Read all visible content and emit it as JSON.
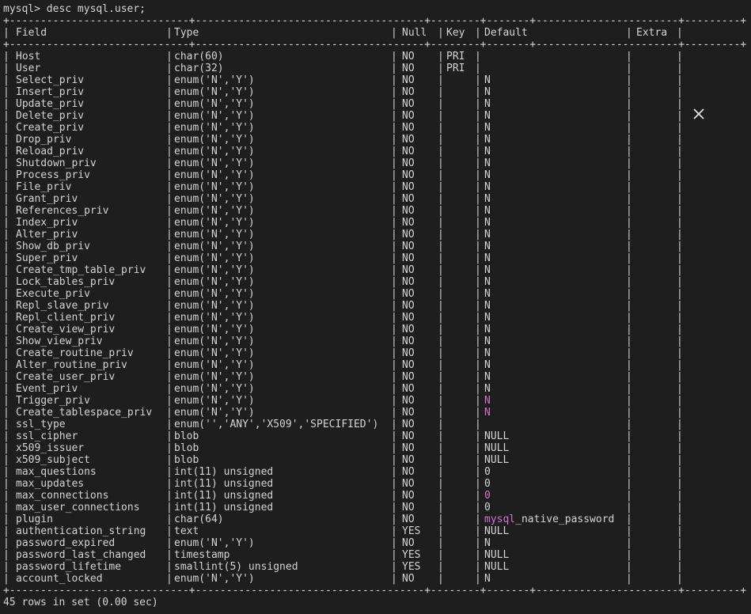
{
  "command_line": "mysql> desc mysql.user;",
  "border": "+-----------------------------+-------------------------------------+--------+-------+-----------------------+---------+",
  "headers": [
    "Field",
    "Type",
    "Null",
    "Key",
    "Default",
    "Extra"
  ],
  "rows": [
    [
      "Host",
      "char(60)",
      "NO",
      "PRI",
      "",
      ""
    ],
    [
      "User",
      "char(32)",
      "NO",
      "PRI",
      "",
      ""
    ],
    [
      "Select_priv",
      "enum('N','Y')",
      "NO",
      "",
      "N",
      ""
    ],
    [
      "Insert_priv",
      "enum('N','Y')",
      "NO",
      "",
      "N",
      ""
    ],
    [
      "Update_priv",
      "enum('N','Y')",
      "NO",
      "",
      "N",
      ""
    ],
    [
      "Delete_priv",
      "enum('N','Y')",
      "NO",
      "",
      "N",
      ""
    ],
    [
      "Create_priv",
      "enum('N','Y')",
      "NO",
      "",
      "N",
      ""
    ],
    [
      "Drop_priv",
      "enum('N','Y')",
      "NO",
      "",
      "N",
      ""
    ],
    [
      "Reload_priv",
      "enum('N','Y')",
      "NO",
      "",
      "N",
      ""
    ],
    [
      "Shutdown_priv",
      "enum('N','Y')",
      "NO",
      "",
      "N",
      ""
    ],
    [
      "Process_priv",
      "enum('N','Y')",
      "NO",
      "",
      "N",
      ""
    ],
    [
      "File_priv",
      "enum('N','Y')",
      "NO",
      "",
      "N",
      ""
    ],
    [
      "Grant_priv",
      "enum('N','Y')",
      "NO",
      "",
      "N",
      ""
    ],
    [
      "References_priv",
      "enum('N','Y')",
      "NO",
      "",
      "N",
      ""
    ],
    [
      "Index_priv",
      "enum('N','Y')",
      "NO",
      "",
      "N",
      ""
    ],
    [
      "Alter_priv",
      "enum('N','Y')",
      "NO",
      "",
      "N",
      ""
    ],
    [
      "Show_db_priv",
      "enum('N','Y')",
      "NO",
      "",
      "N",
      ""
    ],
    [
      "Super_priv",
      "enum('N','Y')",
      "NO",
      "",
      "N",
      ""
    ],
    [
      "Create_tmp_table_priv",
      "enum('N','Y')",
      "NO",
      "",
      "N",
      ""
    ],
    [
      "Lock_tables_priv",
      "enum('N','Y')",
      "NO",
      "",
      "N",
      ""
    ],
    [
      "Execute_priv",
      "enum('N','Y')",
      "NO",
      "",
      "N",
      ""
    ],
    [
      "Repl_slave_priv",
      "enum('N','Y')",
      "NO",
      "",
      "N",
      ""
    ],
    [
      "Repl_client_priv",
      "enum('N','Y')",
      "NO",
      "",
      "N",
      ""
    ],
    [
      "Create_view_priv",
      "enum('N','Y')",
      "NO",
      "",
      "N",
      ""
    ],
    [
      "Show_view_priv",
      "enum('N','Y')",
      "NO",
      "",
      "N",
      ""
    ],
    [
      "Create_routine_priv",
      "enum('N','Y')",
      "NO",
      "",
      "N",
      ""
    ],
    [
      "Alter_routine_priv",
      "enum('N','Y')",
      "NO",
      "",
      "N",
      ""
    ],
    [
      "Create_user_priv",
      "enum('N','Y')",
      "NO",
      "",
      "N",
      ""
    ],
    [
      "Event_priv",
      "enum('N','Y')",
      "NO",
      "",
      "N",
      ""
    ],
    [
      "Trigger_priv",
      "enum('N','Y')",
      "NO",
      "",
      "N",
      ""
    ],
    [
      "Create_tablespace_priv",
      "enum('N','Y')",
      "NO",
      "",
      "N",
      ""
    ],
    [
      "ssl_type",
      "enum('','ANY','X509','SPECIFIED')",
      "NO",
      "",
      "",
      ""
    ],
    [
      "ssl_cipher",
      "blob",
      "NO",
      "",
      "NULL",
      ""
    ],
    [
      "x509_issuer",
      "blob",
      "NO",
      "",
      "NULL",
      ""
    ],
    [
      "x509_subject",
      "blob",
      "NO",
      "",
      "NULL",
      ""
    ],
    [
      "max_questions",
      "int(11) unsigned",
      "NO",
      "",
      "0",
      ""
    ],
    [
      "max_updates",
      "int(11) unsigned",
      "NO",
      "",
      "0",
      ""
    ],
    [
      "max_connections",
      "int(11) unsigned",
      "NO",
      "",
      "0",
      ""
    ],
    [
      "max_user_connections",
      "int(11) unsigned",
      "NO",
      "",
      "0",
      ""
    ],
    [
      "plugin",
      "char(64)",
      "NO",
      "",
      "mysql_native_password",
      ""
    ],
    [
      "authentication_string",
      "text",
      "YES",
      "",
      "NULL",
      ""
    ],
    [
      "password_expired",
      "enum('N','Y')",
      "NO",
      "",
      "N",
      ""
    ],
    [
      "password_last_changed",
      "timestamp",
      "YES",
      "",
      "NULL",
      ""
    ],
    [
      "password_lifetime",
      "smallint(5) unsigned",
      "YES",
      "",
      "NULL",
      ""
    ],
    [
      "account_locked",
      "enum('N','Y')",
      "NO",
      "",
      "N",
      ""
    ]
  ],
  "highlight_color": "#d670d6",
  "footer": "45 rows in set (0.00 sec)",
  "close_icon": "close-icon"
}
